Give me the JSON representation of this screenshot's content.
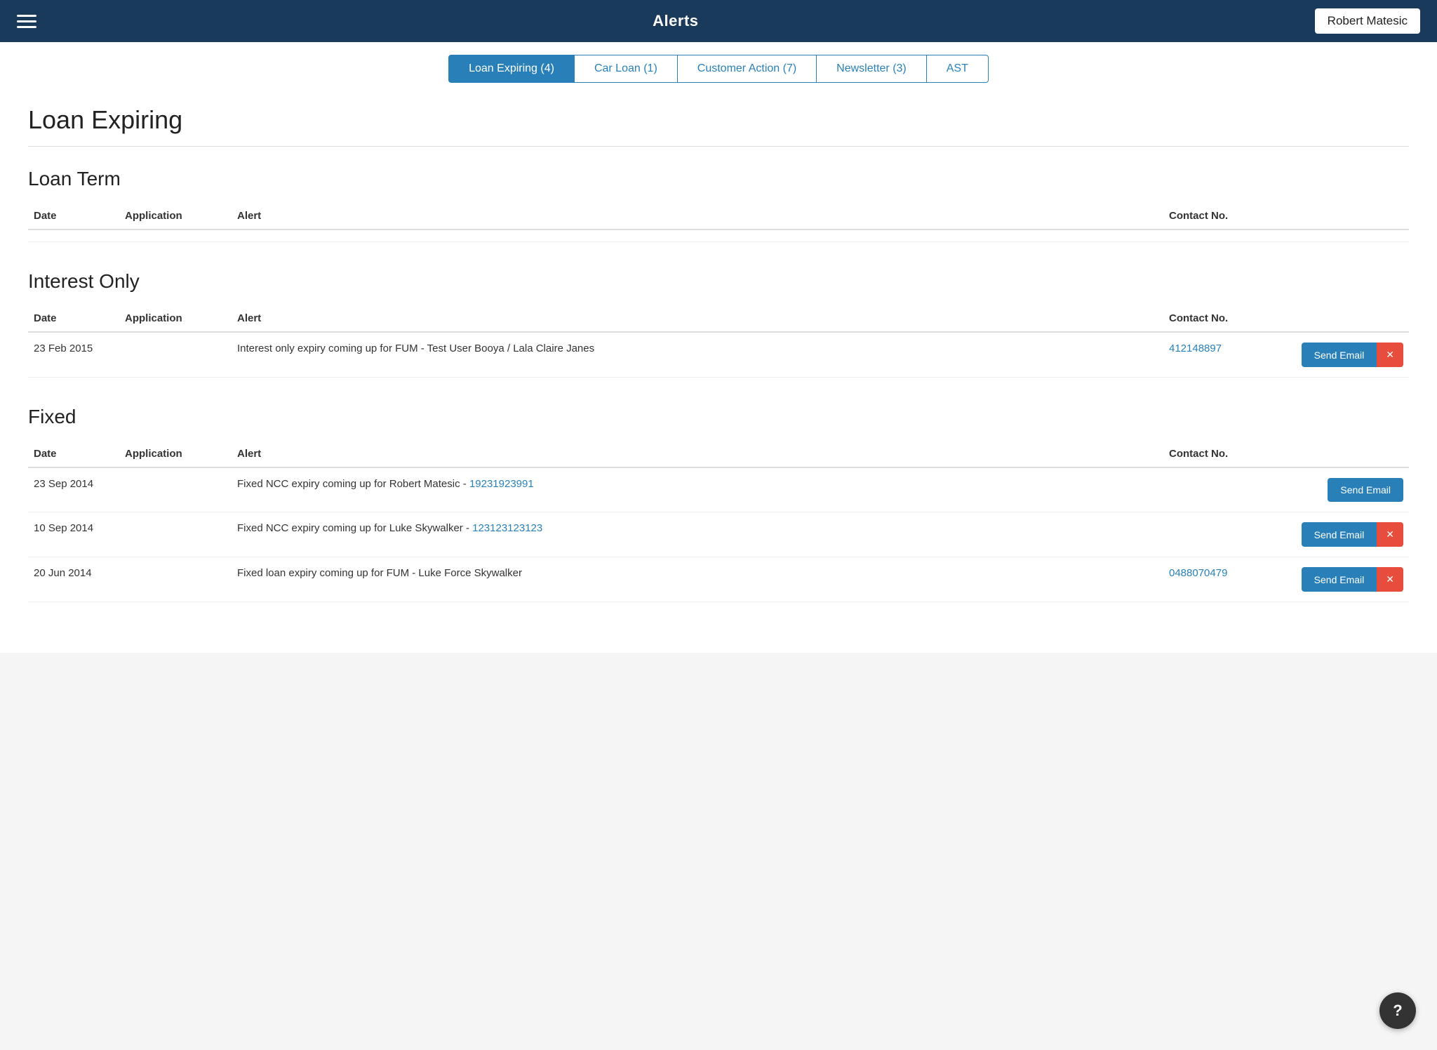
{
  "header": {
    "title": "Alerts",
    "hamburger_label": "Menu",
    "user": "Robert Matesic"
  },
  "tabs": [
    {
      "id": "loan-expiring",
      "label": "Loan Expiring (4)",
      "active": true
    },
    {
      "id": "car-loan",
      "label": "Car Loan (1)",
      "active": false
    },
    {
      "id": "customer-action",
      "label": "Customer Action (7)",
      "active": false
    },
    {
      "id": "newsletter",
      "label": "Newsletter (3)",
      "active": false
    },
    {
      "id": "ast",
      "label": "AST",
      "active": false
    }
  ],
  "page_title": "Loan Expiring",
  "sections": [
    {
      "id": "loan-term",
      "title": "Loan Term",
      "columns": [
        "Date",
        "Application",
        "Alert",
        "Contact No."
      ],
      "rows": []
    },
    {
      "id": "interest-only",
      "title": "Interest Only",
      "columns": [
        "Date",
        "Application",
        "Alert",
        "Contact No."
      ],
      "rows": [
        {
          "date": "23 Feb 2015",
          "application": "",
          "alert": "Interest only expiry coming up for FUM - Test User Booya / Lala Claire Janes",
          "contact": "412148897",
          "contact_link": true,
          "has_dismiss": true,
          "action_label": "Send Email"
        }
      ]
    },
    {
      "id": "fixed",
      "title": "Fixed",
      "columns": [
        "Date",
        "Application",
        "Alert",
        "Contact No."
      ],
      "rows": [
        {
          "date": "23 Sep 2014",
          "application": "",
          "alert_prefix": "Fixed NCC expiry coming up for Robert Matesic - ",
          "alert_link": "19231923991",
          "contact": "",
          "contact_link": false,
          "has_dismiss": false,
          "action_label": "Send Email"
        },
        {
          "date": "10 Sep 2014",
          "application": "",
          "alert_prefix": "Fixed NCC expiry coming up for Luke Skywalker - ",
          "alert_link": "123123123123",
          "contact": "",
          "contact_link": false,
          "has_dismiss": true,
          "action_label": "Send Email"
        },
        {
          "date": "20 Jun 2014",
          "application": "",
          "alert_prefix": "Fixed loan expiry coming up for FUM - Luke Force Skywalker",
          "alert_link": "",
          "contact": "0488070479",
          "contact_link": true,
          "has_dismiss": true,
          "action_label": "Send Email"
        }
      ]
    }
  ],
  "help_label": "?"
}
